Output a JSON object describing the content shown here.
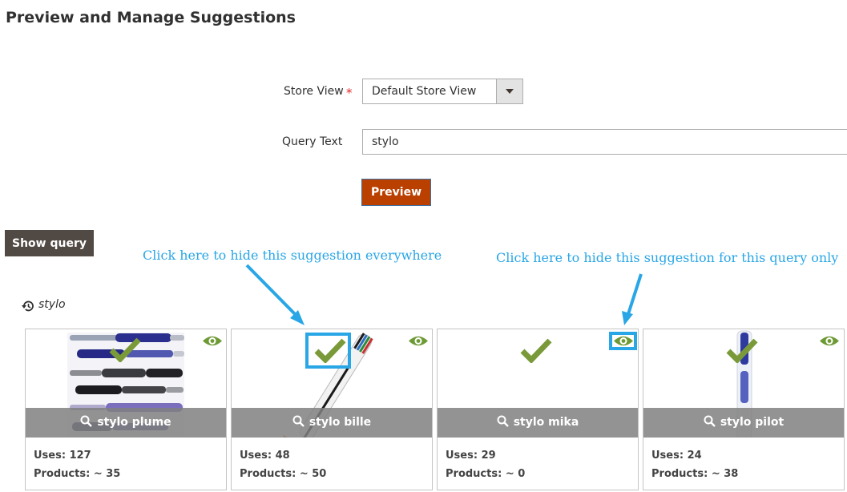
{
  "page": {
    "title": "Preview and Manage Suggestions"
  },
  "form": {
    "store_view_label": "Store View",
    "store_view_required": "*",
    "store_view_value": "Default Store View",
    "query_text_label": "Query Text",
    "query_text_value": "stylo",
    "preview_button": "Preview"
  },
  "show_query_button": "Show query",
  "annotations": {
    "hide_everywhere": "Click here to hide this suggestion everywhere",
    "hide_query_only": "Click here to hide this suggestion for this query only",
    "color": "#29a6e6"
  },
  "query_history": {
    "icon": "history-icon",
    "text": "stylo"
  },
  "cards": [
    {
      "name": "stylo plume",
      "uses": "Uses: 127",
      "products": "Products: ~ 35"
    },
    {
      "name": "stylo bille",
      "uses": "Uses: 48",
      "products": "Products: ~ 50"
    },
    {
      "name": "stylo mika",
      "uses": "Uses: 29",
      "products": "Products: ~ 0"
    },
    {
      "name": "stylo pilot",
      "uses": "Uses: 24",
      "products": "Products: ~ 38"
    }
  ],
  "colors": {
    "check": "#7a9a3a",
    "eye": "#6e9a35",
    "preview_button": "#ba4000",
    "show_query_button": "#514943"
  }
}
